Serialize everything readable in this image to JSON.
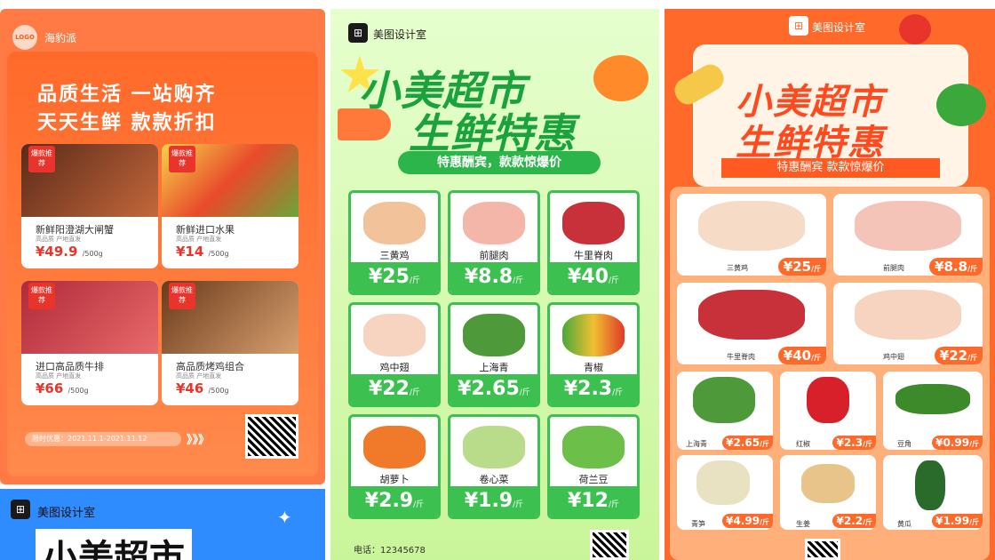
{
  "poster1": {
    "logo_text": "LOGO",
    "brand": "海豹派",
    "slogan_line1": "品质生活 一站购齐",
    "slogan_line2": "天天生鲜 款款折扣",
    "badge": "爆款推荐",
    "products": [
      {
        "name": "新鲜阳澄湖大闸蟹",
        "sub": "高品质 产地直发",
        "price": "¥49.9",
        "unit": "/500g"
      },
      {
        "name": "新鲜进口水果",
        "sub": "高品质 产地直发",
        "price": "¥14",
        "unit": "/500g"
      },
      {
        "name": "进口高品质牛排",
        "sub": "高品质 产地直发",
        "price": "¥66",
        "unit": "/500g"
      },
      {
        "name": "高品质烤鸡组合",
        "sub": "高品质 产地直发",
        "price": "¥46",
        "unit": "/500g"
      }
    ],
    "promo": "限时优惠：2021.11.1-2021.11.12",
    "arrows": "》》》"
  },
  "poster1b": {
    "brand": "美图设计室",
    "title": "小美超市"
  },
  "poster2": {
    "brand": "美图设计室",
    "title_line1": "小美超市",
    "title_line2": "生鲜特惠",
    "ribbon": "特惠酬宾，款款惊爆价",
    "unit": "/斤",
    "items": [
      {
        "name": "三黄鸡",
        "price": "¥25"
      },
      {
        "name": "前腿肉",
        "price": "¥8.8"
      },
      {
        "name": "牛里脊肉",
        "price": "¥40"
      },
      {
        "name": "鸡中翅",
        "price": "¥22"
      },
      {
        "name": "上海青",
        "price": "¥2.65"
      },
      {
        "name": "青椒",
        "price": "¥2.3"
      },
      {
        "name": "胡萝卜",
        "price": "¥2.9"
      },
      {
        "name": "卷心菜",
        "price": "¥1.9"
      },
      {
        "name": "荷兰豆",
        "price": "¥12"
      }
    ],
    "phone": "电话：12345678"
  },
  "poster3": {
    "brand": "美图设计室",
    "title_line1": "小美超市",
    "title_line2": "生鲜特惠",
    "ribbon": "特惠酬宾 款款惊爆价",
    "unit": "/斤",
    "big_items": [
      {
        "name": "三黄鸡",
        "price": "¥25"
      },
      {
        "name": "前腿肉",
        "price": "¥8.8"
      },
      {
        "name": "牛里脊肉",
        "price": "¥40"
      },
      {
        "name": "鸡中翅",
        "price": "¥22"
      }
    ],
    "small_items": [
      {
        "name": "上海青",
        "price": "¥2.65"
      },
      {
        "name": "红椒",
        "price": "¥2.3"
      },
      {
        "name": "豆角",
        "price": "¥0.99"
      },
      {
        "name": "青笋",
        "price": "¥4.99"
      },
      {
        "name": "生姜",
        "price": "¥2.2"
      },
      {
        "name": "黄瓜",
        "price": "¥1.99"
      }
    ]
  },
  "colors": {
    "orange": "#ff6a2a",
    "green": "#3cc050",
    "red": "#e8342a"
  }
}
